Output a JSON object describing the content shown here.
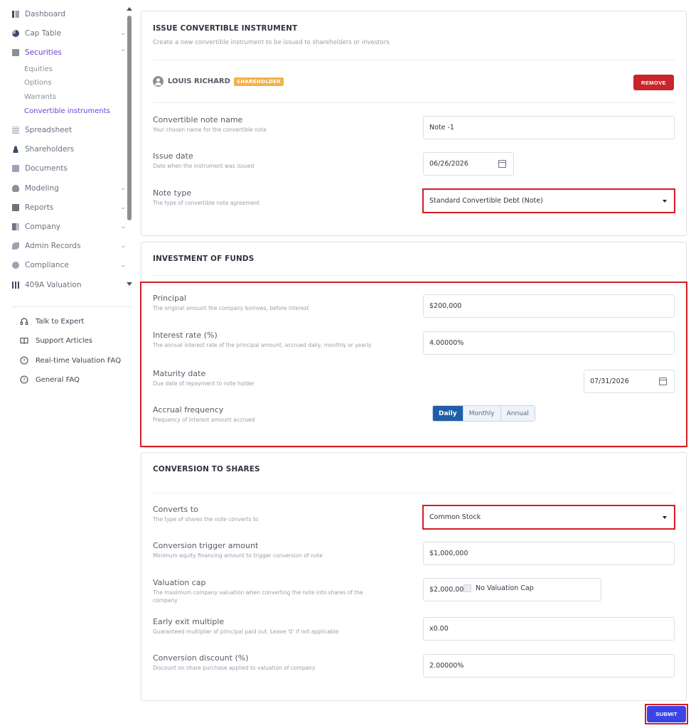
{
  "sidebar": {
    "items": [
      {
        "label": "Dashboard",
        "icon": "dashboard-icon",
        "chevron": ""
      },
      {
        "label": "Cap Table",
        "icon": "pie-chart-icon",
        "chevron": "⌄"
      },
      {
        "label": "Securities",
        "icon": "clipboard-icon",
        "chevron": "⌃"
      },
      {
        "label": "Spreadsheet",
        "icon": "spreadsheet-icon",
        "chevron": ""
      },
      {
        "label": "Shareholders",
        "icon": "person-icon",
        "chevron": ""
      },
      {
        "label": "Documents",
        "icon": "folder-icon",
        "chevron": ""
      },
      {
        "label": "Modeling",
        "icon": "lightbulb-icon",
        "chevron": "⌄"
      },
      {
        "label": "Reports",
        "icon": "report-icon",
        "chevron": "⌄"
      },
      {
        "label": "Company",
        "icon": "building-icon",
        "chevron": "⌄"
      },
      {
        "label": "Admin Records",
        "icon": "records-icon",
        "chevron": "⌄"
      },
      {
        "label": "Compliance",
        "icon": "shield-icon",
        "chevron": "⌄"
      },
      {
        "label": "409A Valuation",
        "icon": "chart-icon",
        "chevron": ""
      }
    ],
    "securities_sub": [
      {
        "label": "Equities"
      },
      {
        "label": "Options"
      },
      {
        "label": "Warrants"
      },
      {
        "label": "Convertible instruments"
      }
    ],
    "help": [
      {
        "label": "Talk to Expert",
        "icon": "headset-icon",
        "glyph": "☊"
      },
      {
        "label": "Support Articles",
        "icon": "book-icon",
        "glyph": "📖"
      },
      {
        "label": "Real-time Valuation FAQ",
        "icon": "question-circle-icon",
        "glyph": "?"
      },
      {
        "label": "General FAQ",
        "icon": "question-circle-icon",
        "glyph": "?"
      }
    ]
  },
  "issue": {
    "title": "ISSUE CONVERTIBLE INSTRUMENT",
    "subtitle": "Create a new convertible instrument to be issued to shareholders or investors",
    "shareholder_name": "LOUIS RICHARD",
    "shareholder_badge": "SHAREHOLDER",
    "remove_label": "REMOVE",
    "note_name": {
      "label": "Convertible note name",
      "help": "Your chosen name for the convertible note",
      "value": "Note -1"
    },
    "issue_date": {
      "label": "Issue date",
      "help": "Date when the instrument was issued",
      "value": "06/26/2026"
    },
    "note_type": {
      "label": "Note type",
      "help": "The type of convertible note agreement",
      "value": "Standard Convertible Debt (Note)"
    }
  },
  "investment": {
    "title": "INVESTMENT OF FUNDS",
    "principal": {
      "label": "Principal",
      "help": "The original amount the company borrows, before interest",
      "value": "$200,000"
    },
    "interest": {
      "label": "Interest rate (%)",
      "help": "The annual interest rate of the principal amount, accrued daily, monthly or yearly",
      "value": "4.00000%"
    },
    "maturity": {
      "label": "Maturity date",
      "help": "Due date of repayment to note holder",
      "value": "07/31/2026"
    },
    "accrual": {
      "label": "Accrual frequency",
      "help": "Frequency of interest amount accrued",
      "options": [
        "Daily",
        "Monthly",
        "Annual"
      ],
      "selected": "Daily"
    }
  },
  "conversion": {
    "title": "CONVERSION TO SHARES",
    "converts_to": {
      "label": "Converts to",
      "help": "The type of shares the note converts to",
      "value": "Common Stock"
    },
    "trigger": {
      "label": "Conversion trigger amount",
      "help": "Minimum equity financing amount to trigger conversion of note",
      "value": "$1,000,000"
    },
    "cap": {
      "label": "Valuation cap",
      "help": "The maximum company valuation when converting the note into shares of the company",
      "value": "$2,000,000",
      "no_cap_label": "No Valuation Cap"
    },
    "exit": {
      "label": "Early exit multiple",
      "help": "Guaranteed multiplier of principal paid out. Leave '0' if not applicable",
      "value": "x0.00"
    },
    "discount": {
      "label": "Conversion discount (%)",
      "help": "Discount on share purchase applied to valuation of company",
      "value": "2.00000%"
    }
  },
  "submit_label": "SUBMIT",
  "colors": {
    "accent": "#6d3fd8",
    "highlight": "#d51c24",
    "remove": "#c9252c",
    "submit": "#3c43e6",
    "segment_active": "#1f5fa8",
    "badge": "#f3b14a"
  }
}
